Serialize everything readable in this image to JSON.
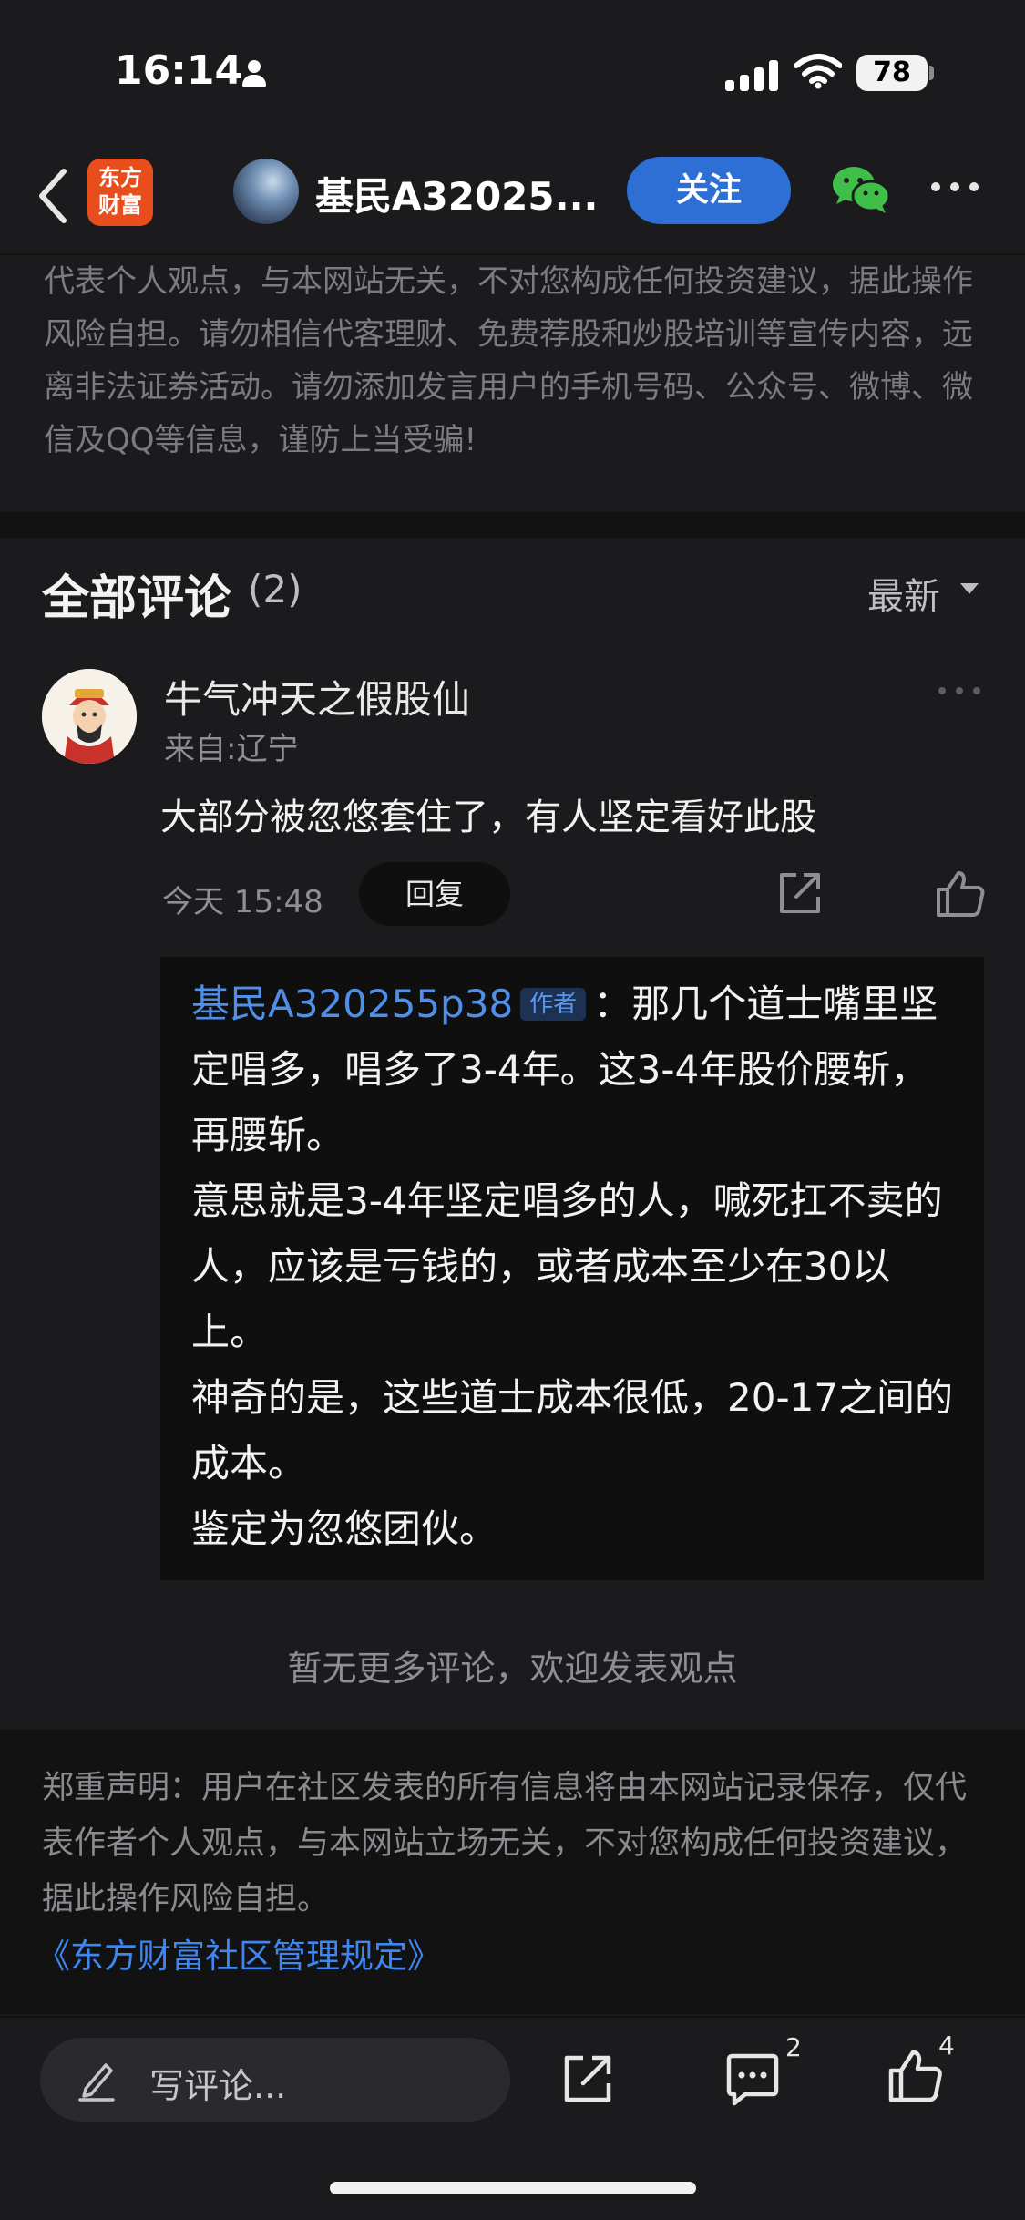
{
  "status": {
    "time": "16:14",
    "battery": "78"
  },
  "nav": {
    "logo_line1": "东方",
    "logo_line2": "财富",
    "title": "基民A32025...",
    "follow_label": "关注"
  },
  "top_disclaimer": "代表个人观点，与本网站无关，不对您构成任何投资建议，据此操作风险自担。请勿相信代客理财、免费荐股和炒股培训等宣传内容，远离非法证券活动。请勿添加发言用户的手机号码、公众号、微博、微信及QQ等信息，谨防上当受骗!",
  "comments": {
    "title": "全部评论",
    "count": "(2)",
    "sort_label": "最新"
  },
  "comment": {
    "user": "牛气冲天之假股仙",
    "origin": "来自:辽宁",
    "text": "大部分被忽悠套住了，有人坚定看好此股",
    "time": "今天 15:48",
    "reply_label": "回复"
  },
  "quote": {
    "author": "基民A320255p38",
    "tag": "作者",
    "colon": "：",
    "text": "那几个道士嘴里坚定唱多，唱多了3-4年。这3-4年股价腰斩，再腰斩。\n意思就是3-4年坚定唱多的人，喊死扛不卖的人，应该是亏钱的，或者成本至少在30以上。\n神奇的是，这些道士成本很低，20-17之间的成本。\n鉴定为忽悠团伙。"
  },
  "no_more": "暂无更多评论，欢迎发表观点",
  "footer": {
    "disclaimer": "郑重声明：用户在社区发表的所有信息将由本网站记录保存，仅代表作者个人观点，与本网站立场无关，不对您构成任何投资建议，据此操作风险自担。",
    "link": "《东方财富社区管理规定》"
  },
  "bottom_bar": {
    "input_placeholder": "写评论...",
    "comment_count": "2",
    "like_count": "4"
  },
  "colors": {
    "accent": "#2e6fd6",
    "link": "#3f86f0",
    "logo": "#e84d1c",
    "wechat": "#3fbf4a"
  }
}
